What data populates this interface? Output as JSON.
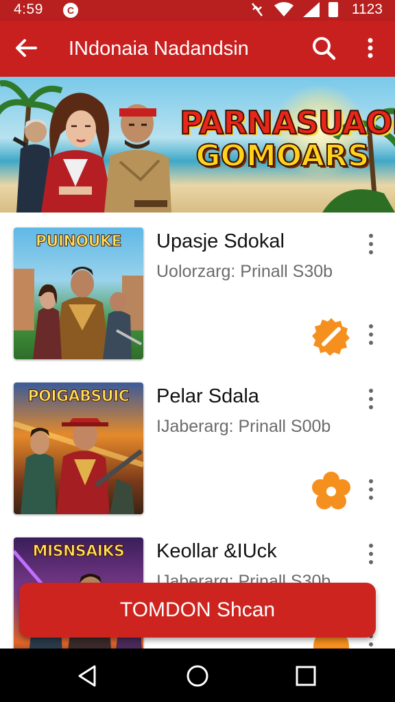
{
  "status_bar": {
    "time": "4:59",
    "clock": "1123",
    "notification_icon": "notification-icon"
  },
  "app_bar": {
    "title": "INdonaia Nadandsin"
  },
  "banner": {
    "headline_line1": "PARNASUAON",
    "headline_line2": "GOMOARS"
  },
  "items": [
    {
      "thumb_caption": "PUINOUKE",
      "title": "Upasje Sdokal",
      "subtitle": "Uolorzarg: Prinall  S30b",
      "badge_icon": "edit-badge-icon"
    },
    {
      "thumb_caption": "POIGABSUIC",
      "title": "Pelar Sdala",
      "subtitle": "IJaberarg: Prinall  S00b",
      "badge_icon": "flower-badge-icon"
    },
    {
      "thumb_caption": "MISNSAIKS",
      "title": "Keollar &IUck",
      "subtitle": "IJaberarg: Prinall  S30b",
      "badge_icon": "orange-badge-icon"
    }
  ],
  "cta": {
    "label": "TOMDON Shcan"
  },
  "colors": {
    "primary": "#c8201f",
    "status_bar": "#b81f1f",
    "accent": "#f5901e",
    "nav_bar": "#000000"
  }
}
